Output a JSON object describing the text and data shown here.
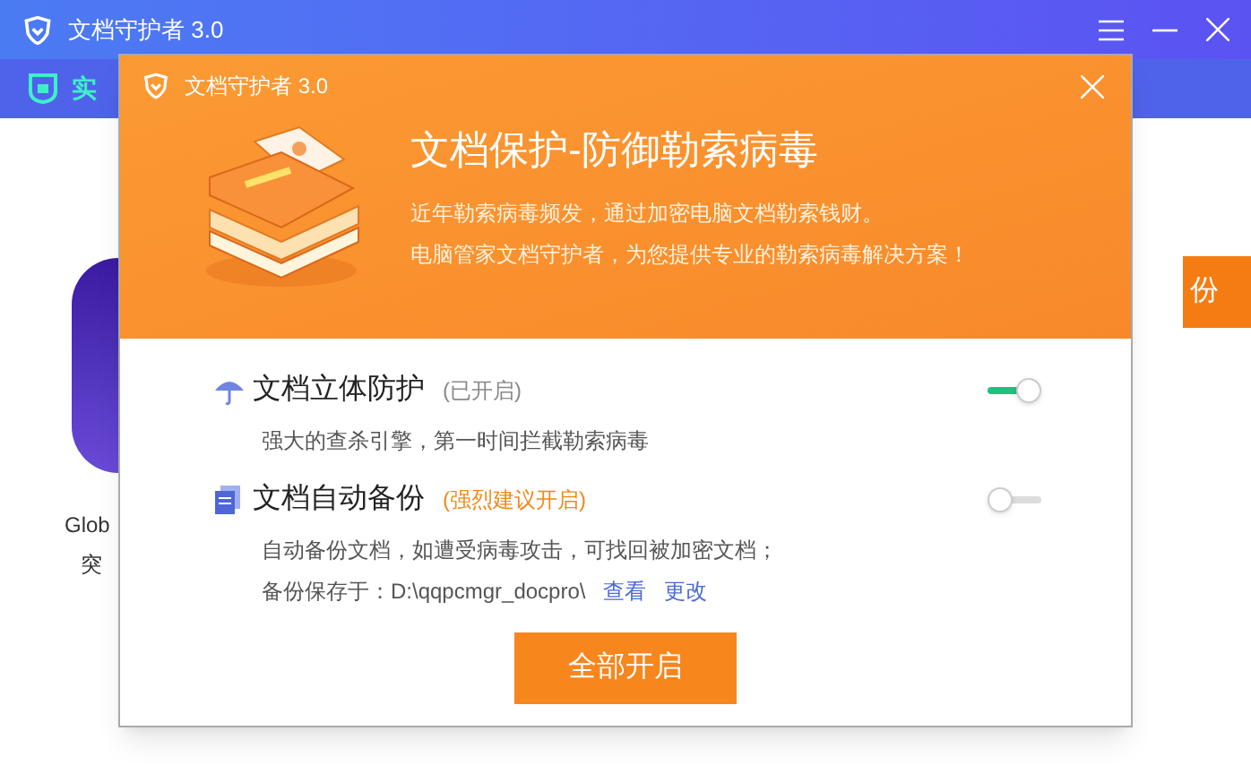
{
  "main_window": {
    "title": "文档守护者 3.0",
    "nav_tab": "实",
    "card_title": "Glob",
    "card_subtitle": "突",
    "side_button": "份"
  },
  "dialog": {
    "title": "文档守护者 3.0",
    "headline": "文档保护-防御勒索病毒",
    "intro": [
      "近年勒索病毒频发，通过加密电脑文档勒索钱财。",
      "电脑管家文档守护者，为您提供专业的勒索病毒解决方案！"
    ],
    "features": [
      {
        "kind": "umbrella",
        "title": "文档立体防护",
        "status": "(已开启)",
        "color": "#8a8a8a",
        "on": true,
        "lines": [
          {
            "text": "强大的查杀引擎，第一时间拦截勒索病毒"
          }
        ]
      },
      {
        "kind": "document",
        "title": "文档自动备份",
        "status": "(强烈建议开启)",
        "color": "#f08a1c",
        "on": false,
        "lines": [
          {
            "text": "自动备份文档，如遭受病毒攻击，可找回被加密文档；"
          },
          {
            "text": "备份保存于：D:\\qqpcmgr_docpro\\",
            "links": [
              "查看",
              "更改"
            ]
          }
        ]
      }
    ],
    "primary_button": "全部开启"
  }
}
